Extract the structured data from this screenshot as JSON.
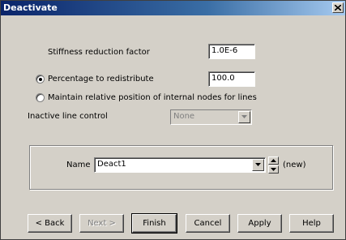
{
  "window": {
    "title": "Deactivate"
  },
  "form": {
    "stiffness_label": "Stiffness reduction factor",
    "stiffness_value": "1.0E-6",
    "percentage_label": "Percentage to redistribute",
    "percentage_value": "100.0",
    "percentage_selected": true,
    "maintain_label": "Maintain relative position of internal nodes for lines",
    "maintain_selected": false,
    "inactive_label": "Inactive line control",
    "inactive_value": "None"
  },
  "name_group": {
    "label": "Name",
    "value": "Deact1",
    "status": "(new)"
  },
  "buttons": {
    "back": "< Back",
    "next": "Next >",
    "finish": "Finish",
    "cancel": "Cancel",
    "apply": "Apply",
    "help": "Help"
  },
  "colors": {
    "title_start": "#0a246a",
    "title_end": "#a6caf0",
    "face": "#d4d0c8"
  }
}
